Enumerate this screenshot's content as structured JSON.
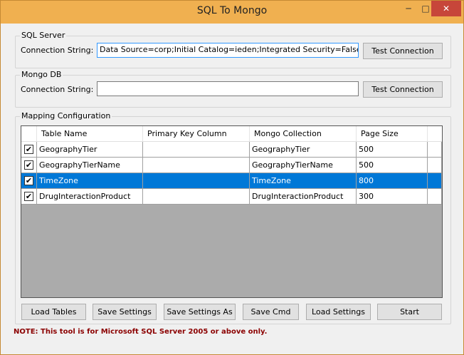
{
  "window": {
    "title": "SQL To Mongo",
    "min": "─",
    "max": "□",
    "close": "✕"
  },
  "sql_server": {
    "group_label": "SQL Server",
    "conn_label": "Connection String:",
    "conn_value": "Data Source=corp;Initial Catalog=ieden;Integrated Security=False;U",
    "test_btn": "Test Connection"
  },
  "mongo_db": {
    "group_label": "Mongo DB",
    "conn_label": "Connection String:",
    "conn_value": "",
    "test_btn": "Test Connection"
  },
  "mapping": {
    "group_label": "Mapping Configuration",
    "columns": [
      "Table Name",
      "Primary Key Column",
      "Mongo Collection",
      "Page Size"
    ],
    "rows": [
      {
        "checked": true,
        "table": "GeographyTier",
        "pk": "",
        "collection": "GeographyTier",
        "page_size": "500",
        "selected": false
      },
      {
        "checked": true,
        "table": "GeographyTierName",
        "pk": "",
        "collection": "GeographyTierName",
        "page_size": "500",
        "selected": false
      },
      {
        "checked": true,
        "table": "TimeZone",
        "pk": "",
        "collection": "TimeZone",
        "page_size": "800",
        "selected": true
      },
      {
        "checked": true,
        "table": "DrugInteractionProduct",
        "pk": "",
        "collection": "DrugInteractionProduct",
        "page_size": "300",
        "selected": false
      }
    ],
    "check_glyph": "✔",
    "buttons": {
      "load_tables": "Load Tables",
      "save_settings": "Save Settings",
      "save_settings_as": "Save Settings As",
      "save_cmd": "Save Cmd",
      "load_settings": "Load Settings",
      "start": "Start"
    }
  },
  "note": "NOTE: This tool is for Microsoft SQL Server 2005 or above only.",
  "colors": {
    "title_bar": "#f0b050",
    "close": "#c7463a",
    "selection": "#0078d7",
    "note": "#8b0000"
  }
}
